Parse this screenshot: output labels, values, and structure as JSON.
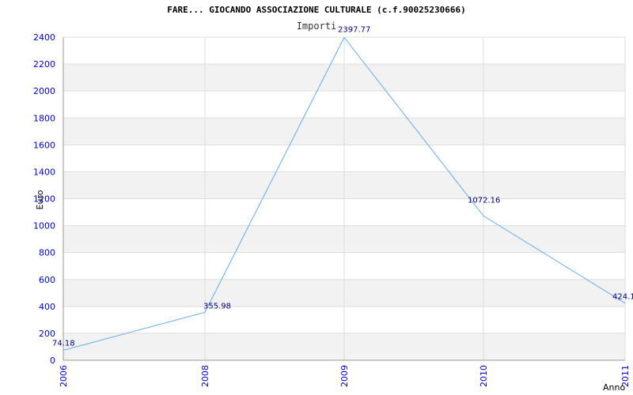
{
  "chart_data": {
    "type": "line",
    "title": "FARE... GIOCANDO ASSOCIAZIONE CULTURALE (c.f.90025230666)",
    "subtitle": "Importi",
    "xlabel": "Anno",
    "ylabel": "Euro",
    "categories": [
      "2006",
      "2008",
      "2009",
      "2010",
      "2011"
    ],
    "series": [
      {
        "values": [
          74.18,
          355.98,
          2397.77,
          1072.16,
          424.1
        ],
        "labels": [
          "74.18",
          "355.98",
          "2397.77",
          "1072.16",
          "424.1"
        ],
        "color": "#66aaee"
      }
    ],
    "ylim": [
      0,
      2400
    ],
    "yticks": [
      0,
      200,
      400,
      600,
      800,
      1000,
      1200,
      1400,
      1600,
      1800,
      2000,
      2200,
      2400
    ],
    "grid": true,
    "band_colors": [
      "#f2f2f2",
      "#ffffff"
    ],
    "tick_color": "#0000cc",
    "label_color": "#000080"
  }
}
